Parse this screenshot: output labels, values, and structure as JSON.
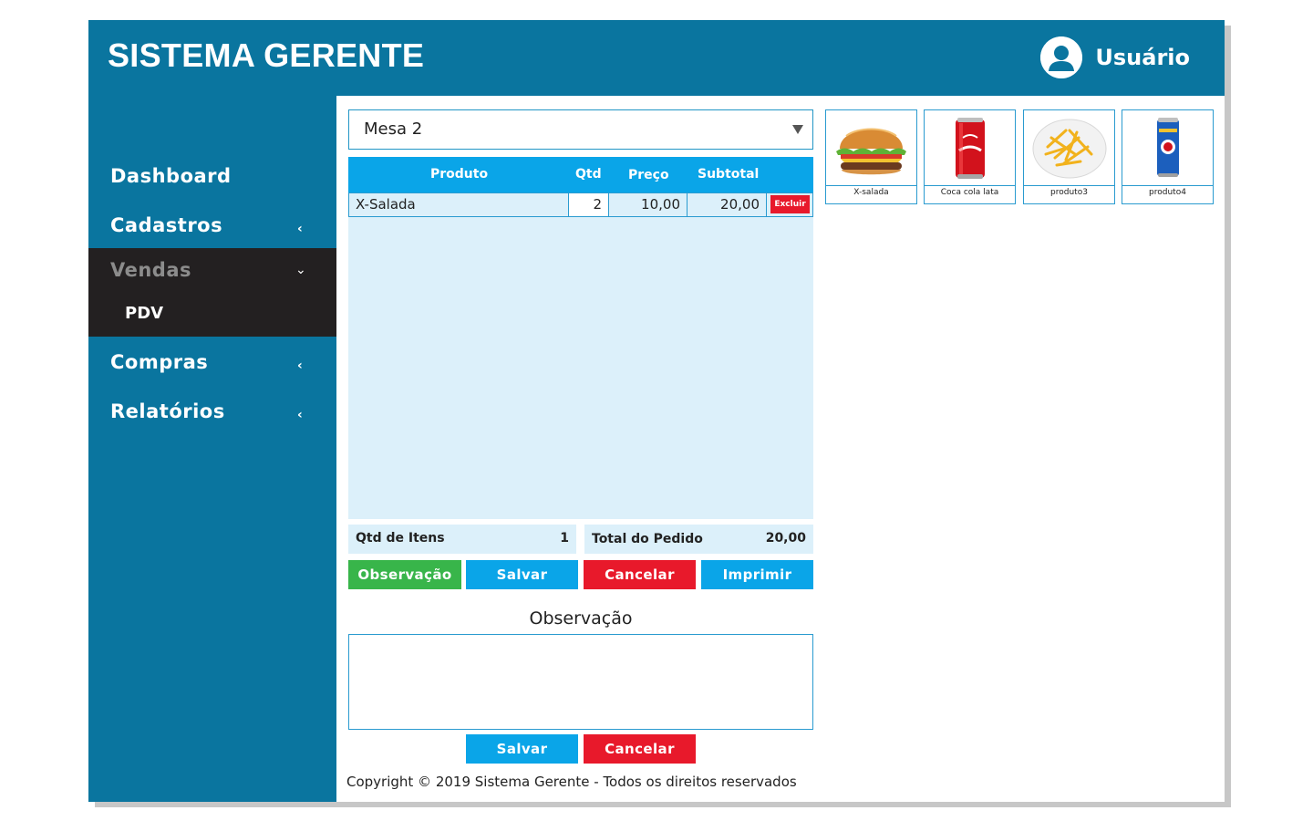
{
  "header": {
    "brand": "SISTEMA GERENTE",
    "user": "Usuário"
  },
  "sidebar": {
    "items": [
      {
        "label": "Dashboard"
      },
      {
        "label": "Cadastros",
        "chevron": "‹"
      },
      {
        "label": "Vendas",
        "chevron": "⌄",
        "sub": [
          "PDV"
        ]
      },
      {
        "label": "Compras",
        "chevron": "‹"
      },
      {
        "label": "Relatórios",
        "chevron": "‹"
      }
    ]
  },
  "main": {
    "table_select": "Mesa 2",
    "table": {
      "headers": [
        "Produto",
        "Qtd",
        "Preço",
        "Subtotal"
      ],
      "rows": [
        {
          "produto": "X-Salada",
          "qtd": "2",
          "preco": "10,00",
          "subtotal": "20,00",
          "action": "Excluir"
        }
      ]
    },
    "summary": {
      "qtd_label": "Qtd de Itens",
      "qtd_value": "1",
      "total_label": "Total do Pedido",
      "total_value": "20,00"
    },
    "actions": {
      "observacao": "Observação",
      "salvar": "Salvar",
      "cancelar": "Cancelar",
      "imprimir": "Imprimir"
    },
    "obs": {
      "title": "Observação",
      "salvar": "Salvar",
      "cancelar": "Cancelar"
    },
    "footer": "Copyright © 2019 Sistema Gerente - Todos os direitos reservados"
  },
  "products": [
    {
      "name": "X-salada",
      "icon": "burger-image"
    },
    {
      "name": "Coca cola lata",
      "icon": "coke-can-image"
    },
    {
      "name": "produto3",
      "icon": "fries-image"
    },
    {
      "name": "produto4",
      "icon": "beer-can-image"
    }
  ],
  "colors": {
    "primary": "#0a759f",
    "accent": "#0aa5e8",
    "danger": "#e8192b",
    "success": "#38b54a",
    "dark": "#232021"
  }
}
